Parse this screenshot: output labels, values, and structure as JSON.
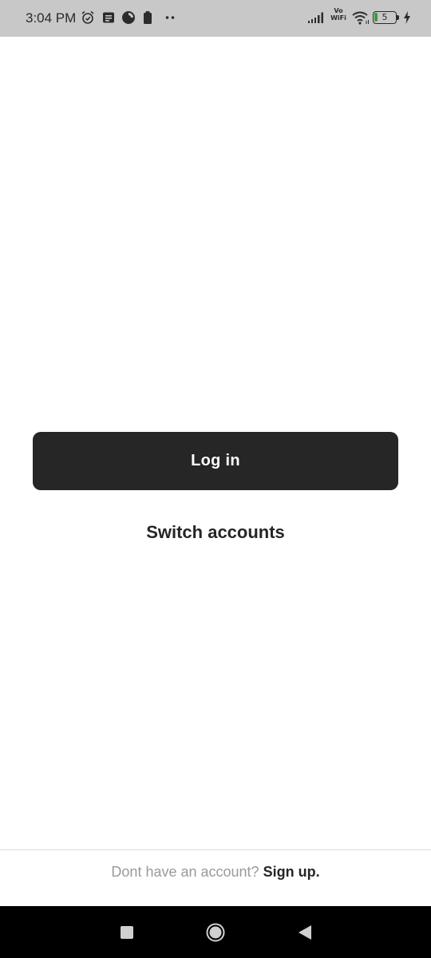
{
  "status_bar": {
    "time": "3:04 PM",
    "vo_line1": "Vo",
    "vo_line2": "WiFi",
    "battery_level": "5",
    "icons": [
      "alarm-icon",
      "message-icon",
      "data-saver-icon",
      "clipboard-icon",
      "more-notifications-icon",
      "signal-icon",
      "vowifi-icon",
      "wifi-icon",
      "battery-icon",
      "charging-icon"
    ]
  },
  "main": {
    "login_label": "Log in",
    "switch_accounts_label": "Switch accounts"
  },
  "footer": {
    "prompt": "Dont have an account?",
    "signup_label": "Sign up."
  },
  "nav_bar": {
    "icons": [
      "recents-icon",
      "home-icon",
      "back-icon"
    ]
  },
  "colors": {
    "button_bg": "#262626",
    "status_bar_bg": "#c8c8c8",
    "prompt_text": "#9a9a9a",
    "nav_bar_bg": "#000000"
  }
}
